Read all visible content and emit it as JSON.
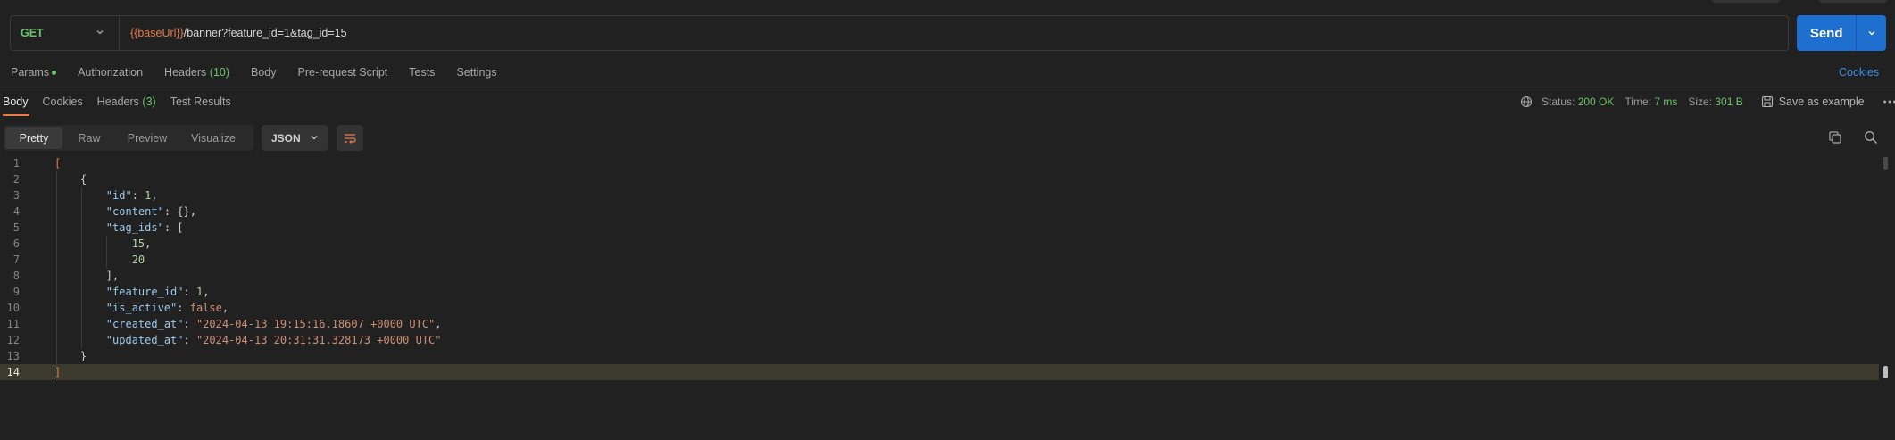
{
  "request": {
    "method": "GET",
    "url_var": "{{baseUrl}}",
    "url_path": "/banner?feature_id=1&tag_id=15",
    "send_label": "Send"
  },
  "request_tabs": {
    "params": "Params",
    "authorization": "Authorization",
    "headers": "Headers",
    "headers_count": "(10)",
    "body": "Body",
    "prerequest": "Pre-request Script",
    "tests": "Tests",
    "settings": "Settings",
    "cookies": "Cookies"
  },
  "response_tabs": {
    "body": "Body",
    "cookies": "Cookies",
    "headers": "Headers",
    "headers_count": "(3)",
    "test_results": "Test Results"
  },
  "response_meta": {
    "status_label": "Status:",
    "status_value": "200 OK",
    "time_label": "Time:",
    "time_value": "7 ms",
    "size_label": "Size:",
    "size_value": "301 B",
    "save_label": "Save as example"
  },
  "view_modes": {
    "pretty": "Pretty",
    "raw": "Raw",
    "preview": "Preview",
    "visualize": "Visualize"
  },
  "format": "JSON",
  "code_lines": [
    {
      "n": "1"
    },
    {
      "n": "2"
    },
    {
      "n": "3"
    },
    {
      "n": "4"
    },
    {
      "n": "5"
    },
    {
      "n": "6"
    },
    {
      "n": "7"
    },
    {
      "n": "8"
    },
    {
      "n": "9"
    },
    {
      "n": "10"
    },
    {
      "n": "11"
    },
    {
      "n": "12"
    },
    {
      "n": "13"
    },
    {
      "n": "14"
    }
  ],
  "json": {
    "key_id": "\"id\"",
    "val_id": "1",
    "key_content": "\"content\"",
    "val_content": "{}",
    "key_tag_ids": "\"tag_ids\"",
    "tag1": "15",
    "tag2": "20",
    "key_feature_id": "\"feature_id\"",
    "val_feature_id": "1",
    "key_is_active": "\"is_active\"",
    "val_is_active": "false",
    "key_created_at": "\"created_at\"",
    "val_created_at": "\"2024-04-13 19:15:16.18607 +0000 UTC\"",
    "key_updated_at": "\"updated_at\"",
    "val_updated_at": "\"2024-04-13 20:31:31.328173 +0000 UTC\""
  },
  "colors": {
    "method_get": "#6cc46c",
    "send_bg": "#1f6fd1",
    "accent": "#e8794a",
    "link": "#3d8de0",
    "background": "#212121"
  }
}
